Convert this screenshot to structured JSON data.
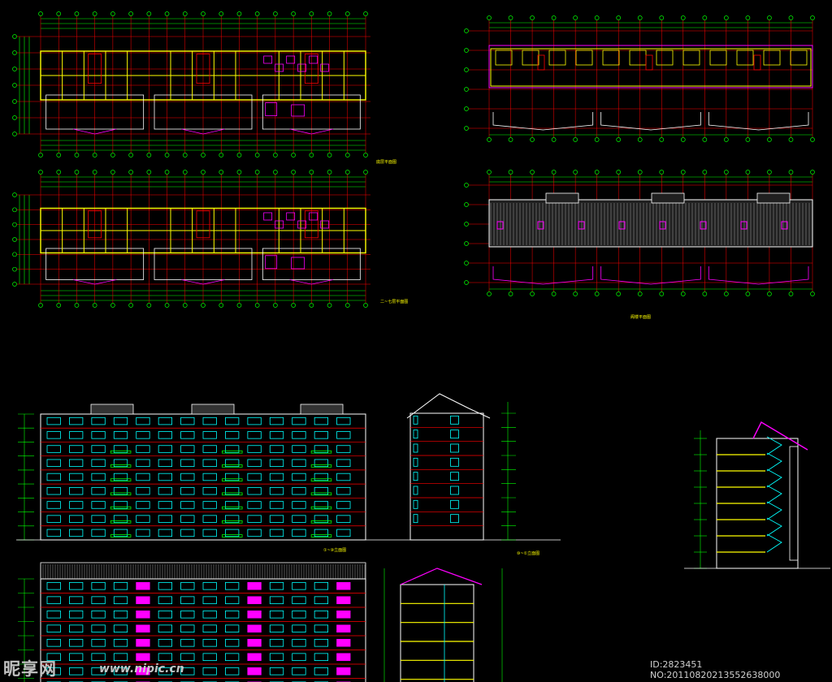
{
  "watermark": {
    "brand": "昵享网",
    "url": "www.nipic.cn",
    "id_text": "ID:2823451 NO:20110820213552638000"
  },
  "drawings": {
    "plan_ground": "底层平面图",
    "plan_typical": "二~七层平面图",
    "plan_attic": "阁楼平面图",
    "elev_front": "①~⑩立面图",
    "elev_back": "⑩~①立面图"
  },
  "colors": {
    "wall": "#ffff00",
    "axis": "#ff0000",
    "dimension": "#00ff00",
    "window": "#00ffff",
    "furniture": "#ff00ff",
    "edge": "#ffffff"
  }
}
